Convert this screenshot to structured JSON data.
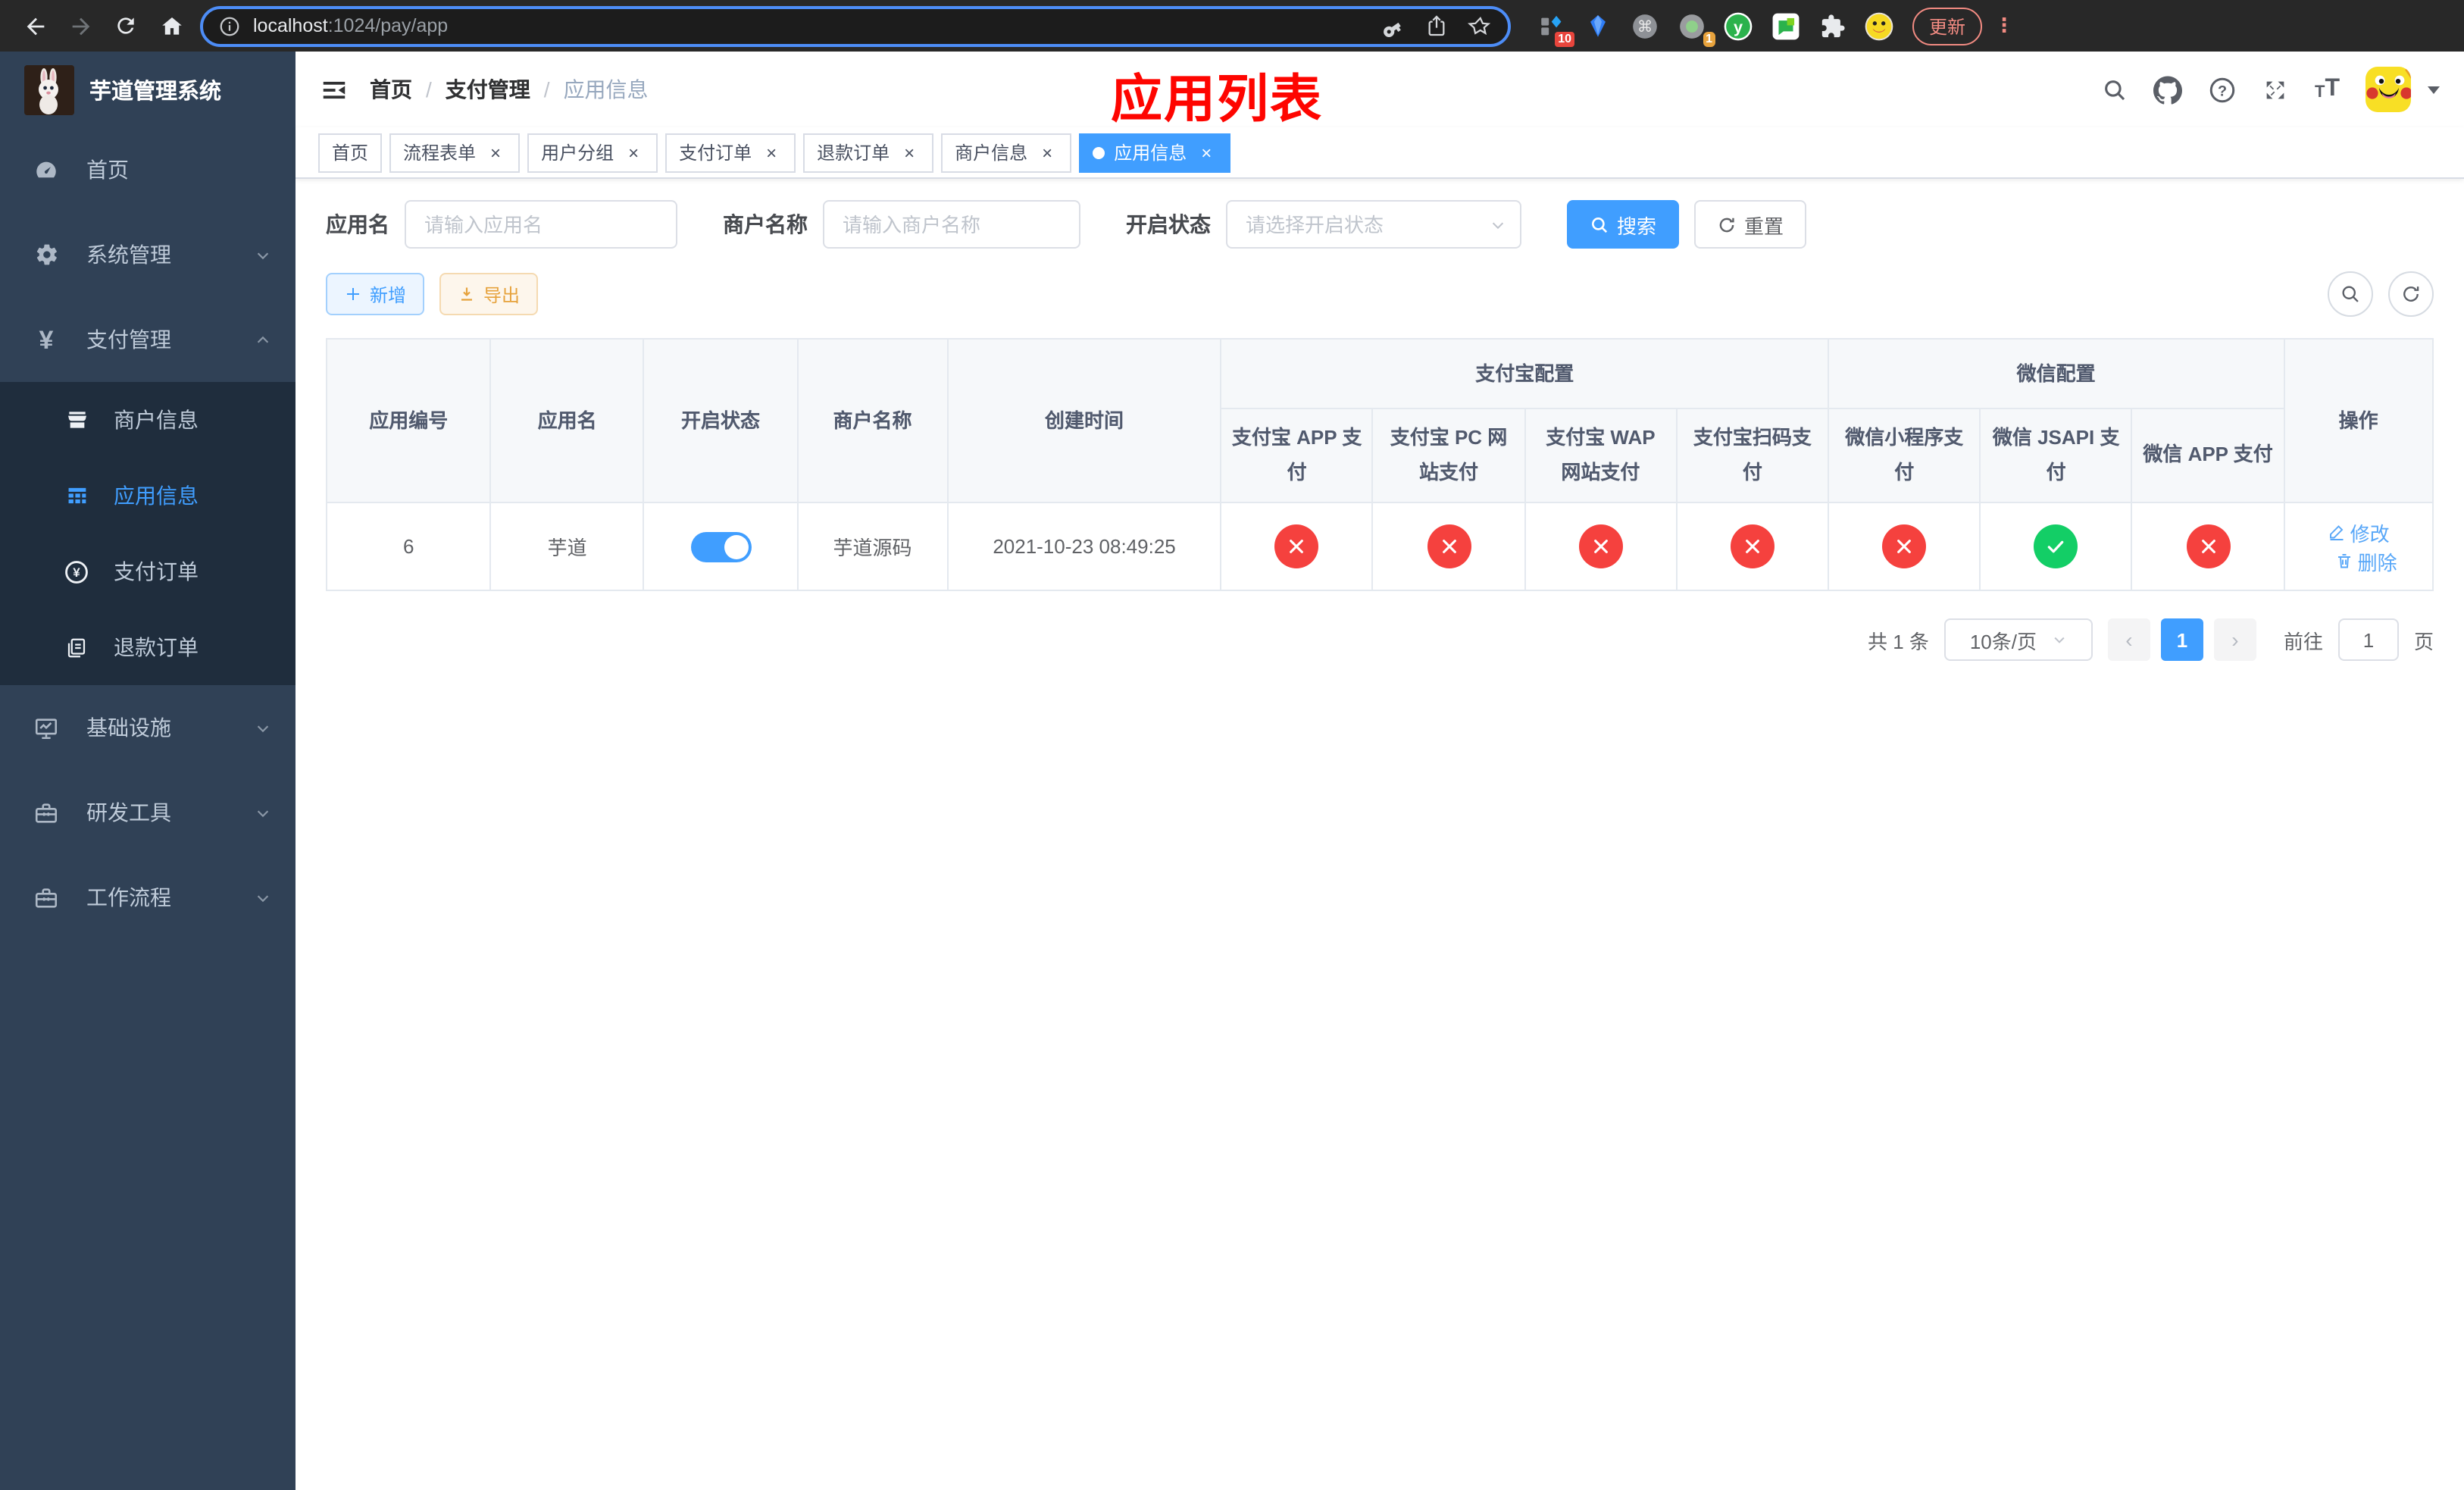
{
  "browser": {
    "url_host": "localhost",
    "url_path": ":1024/pay/app",
    "update_label": "更新",
    "kebab_glyph": "⋮",
    "ext_badge_a": "10",
    "ext_badge_b": "1",
    "ext_y_glyph": "y",
    "ext_cmd_glyph": "⌘"
  },
  "sidebar": {
    "title": "芋道管理系统",
    "yen_glyph": "¥",
    "items": [
      {
        "label": "首页"
      },
      {
        "label": "系统管理"
      },
      {
        "label": "支付管理"
      }
    ],
    "sub_items": [
      {
        "label": "商户信息"
      },
      {
        "label": "应用信息"
      },
      {
        "label": "支付订单"
      },
      {
        "label": "退款订单"
      }
    ],
    "items_bottom": [
      {
        "label": "基础设施"
      },
      {
        "label": "研发工具"
      },
      {
        "label": "工作流程"
      }
    ]
  },
  "header": {
    "breadcrumb": [
      "首页",
      "支付管理",
      "应用信息"
    ],
    "separator": "/",
    "overlay_title": "应用列表",
    "question_glyph": "?",
    "font_icon_glyph": "T"
  },
  "tabs": [
    {
      "label": "首页"
    },
    {
      "label": "流程表单"
    },
    {
      "label": "用户分组"
    },
    {
      "label": "支付订单"
    },
    {
      "label": "退款订单"
    },
    {
      "label": "商户信息"
    },
    {
      "label": "应用信息"
    }
  ],
  "tabs_meta": {
    "close_glyph": "×"
  },
  "filters": {
    "app_name_label": "应用名",
    "app_name_placeholder": "请输入应用名",
    "merchant_label": "商户名称",
    "merchant_placeholder": "请输入商户名称",
    "status_label": "开启状态",
    "status_placeholder": "请选择开启状态",
    "search_label": "搜索",
    "reset_label": "重置"
  },
  "toolbar": {
    "add_label": "新增",
    "export_label": "导出"
  },
  "table": {
    "groups": {
      "alipay": "支付宝配置",
      "wechat": "微信配置"
    },
    "columns": {
      "app_id": "应用编号",
      "app_name": "应用名",
      "status": "开启状态",
      "merchant": "商户名称",
      "created": "创建时间",
      "actions": "操作"
    },
    "sub_columns": [
      "支付宝 APP 支付",
      "支付宝 PC 网站支付",
      "支付宝 WAP 网站支付",
      "支付宝扫码支付",
      "微信小程序支付",
      "微信 JSAPI 支付",
      "微信 APP 支付"
    ],
    "row": {
      "app_id": "6",
      "app_name": "芋道",
      "enabled": true,
      "merchant": "芋道源码",
      "created": "2021-10-23 08:49:25",
      "statuses": [
        false,
        false,
        false,
        false,
        false,
        true,
        false
      ],
      "edit_label": "修改",
      "delete_label": "删除"
    }
  },
  "pagination": {
    "total": "共 1 条",
    "page_size": "10条/页",
    "prev_glyph": "‹",
    "next_glyph": "›",
    "page": "1",
    "goto_label": "前往",
    "goto_value": "1",
    "unit": "页"
  },
  "colors": {
    "accent": "#409eff",
    "success": "#13ce66",
    "danger": "#f5413e",
    "sidebar_bg": "#304156",
    "submenu_bg": "#1f2d3d",
    "annotation_red": "#fe0500"
  }
}
